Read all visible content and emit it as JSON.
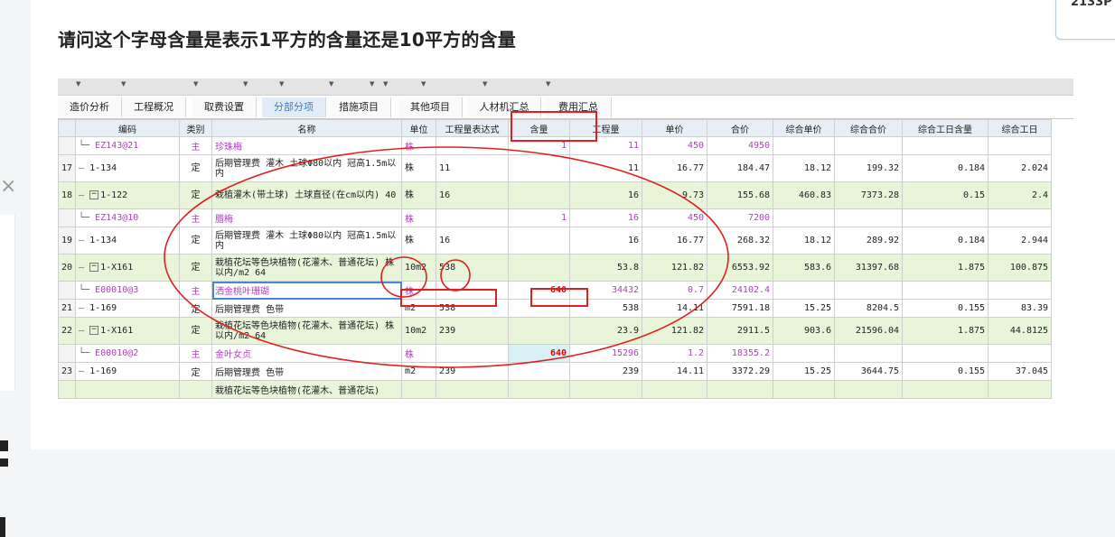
{
  "question": {
    "title": "请问这个字母含量是表示1平方的含量还是10平方的含量"
  },
  "tooltip": {
    "text": "2133P"
  },
  "close_symbol": "×",
  "tabs": [
    {
      "label": "造价分析"
    },
    {
      "label": "工程概况"
    },
    {
      "label": "取费设置"
    },
    {
      "label": "分部分项",
      "active": true
    },
    {
      "label": "措施项目"
    },
    {
      "label": "其他项目"
    },
    {
      "label": "人材机汇总"
    },
    {
      "label": "费用汇总"
    }
  ],
  "columns": [
    "",
    "编码",
    "类别",
    "名称",
    "单位",
    "工程量表达式",
    "含量",
    "工程量",
    "单价",
    "合价",
    "综合单价",
    "综合合价",
    "综合工日含量",
    "综合工日"
  ],
  "rows": [
    {
      "idx": "",
      "code": "EZ143@21",
      "cat": "主",
      "name": "珍珠梅",
      "unit": "株",
      "expr": "",
      "content": "1",
      "qty": "11",
      "price": "450",
      "total": "4950",
      "cprice": "",
      "ctotal": "",
      "wdc": "",
      "wd": "",
      "type": "sub"
    },
    {
      "idx": "17",
      "code": "1-134",
      "cat": "定",
      "name": "后期管理费 灌木 土球Φ80以内 冠高1.5m以内",
      "unit": "株",
      "expr": "11",
      "content": "",
      "qty": "11",
      "price": "16.77",
      "total": "184.47",
      "cprice": "18.12",
      "ctotal": "199.32",
      "wdc": "0.184",
      "wd": "2.024",
      "type": "tall"
    },
    {
      "idx": "18",
      "code": "1-122",
      "cat": "定",
      "name": "栽植灌木(带土球) 土球直径(在cm以内) 40",
      "unit": "株",
      "expr": "16",
      "content": "",
      "qty": "16",
      "price": "9.73",
      "total": "155.68",
      "cprice": "460.83",
      "ctotal": "7373.28",
      "wdc": "0.15",
      "wd": "2.4",
      "type": "tall green",
      "expand": true
    },
    {
      "idx": "",
      "code": "EZ143@10",
      "cat": "主",
      "name": "腊梅",
      "unit": "株",
      "expr": "",
      "content": "1",
      "qty": "16",
      "price": "450",
      "total": "7200",
      "cprice": "",
      "ctotal": "",
      "wdc": "",
      "wd": "",
      "type": "sub"
    },
    {
      "idx": "19",
      "code": "1-134",
      "cat": "定",
      "name": "后期管理费 灌木 土球Φ80以内 冠高1.5m以内",
      "unit": "株",
      "expr": "16",
      "content": "",
      "qty": "16",
      "price": "16.77",
      "total": "268.32",
      "cprice": "18.12",
      "ctotal": "289.92",
      "wdc": "0.184",
      "wd": "2.944",
      "type": "tall"
    },
    {
      "idx": "20",
      "code": "1-X161",
      "cat": "定",
      "name": "栽植花坛等色块植物(花灌木、普通花坛) 株以内/m2 64",
      "unit": "10m2",
      "expr": "538",
      "content": "",
      "qty": "53.8",
      "price": "121.82",
      "total": "6553.92",
      "cprice": "583.6",
      "ctotal": "31397.68",
      "wdc": "1.875",
      "wd": "100.875",
      "type": "tall green",
      "expand": true
    },
    {
      "idx": "",
      "code": "E00010@3",
      "cat": "主",
      "name": "洒金桃叶珊瑚",
      "unit": "株",
      "expr": "",
      "content": "640",
      "qty": "34432",
      "price": "0.7",
      "total": "24102.4",
      "cprice": "",
      "ctotal": "",
      "wdc": "",
      "wd": "",
      "type": "sub selected"
    },
    {
      "idx": "21",
      "code": "1-169",
      "cat": "定",
      "name": "后期管理费 色带",
      "unit": "m2",
      "expr": "538",
      "content": "",
      "qty": "538",
      "price": "14.11",
      "total": "7591.18",
      "cprice": "15.25",
      "ctotal": "8204.5",
      "wdc": "0.155",
      "wd": "83.39",
      "type": ""
    },
    {
      "idx": "22",
      "code": "1-X161",
      "cat": "定",
      "name": "栽植花坛等色块植物(花灌木、普通花坛) 株以内/m2 64",
      "unit": "10m2",
      "expr": "239",
      "content": "",
      "qty": "23.9",
      "price": "121.82",
      "total": "2911.5",
      "cprice": "903.6",
      "ctotal": "21596.04",
      "wdc": "1.875",
      "wd": "44.8125",
      "type": "tall green",
      "expand": true
    },
    {
      "idx": "",
      "code": "E00010@2",
      "cat": "主",
      "name": "金叶女贞",
      "unit": "株",
      "expr": "",
      "content": "640",
      "qty": "15296",
      "price": "1.2",
      "total": "18355.2",
      "cprice": "",
      "ctotal": "",
      "wdc": "",
      "wd": "",
      "type": "sub cyan"
    },
    {
      "idx": "23",
      "code": "1-169",
      "cat": "定",
      "name": "后期管理费 色带",
      "unit": "m2",
      "expr": "239",
      "content": "",
      "qty": "239",
      "price": "14.11",
      "total": "3372.29",
      "cprice": "15.25",
      "ctotal": "3644.75",
      "wdc": "0.155",
      "wd": "37.045",
      "type": ""
    },
    {
      "idx": "",
      "code": "",
      "cat": "",
      "name": "栽植花坛等色块植物(花灌木、普通花坛)",
      "unit": "",
      "expr": "",
      "content": "",
      "qty": "",
      "price": "",
      "total": "",
      "cprice": "",
      "ctotal": "",
      "wdc": "",
      "wd": "",
      "type": "green"
    }
  ],
  "colors": {
    "annotation": "#e02020",
    "subitem_text": "#b040c0",
    "green_row": "#e8f5d8",
    "active_tab": "#3c7bc4"
  }
}
